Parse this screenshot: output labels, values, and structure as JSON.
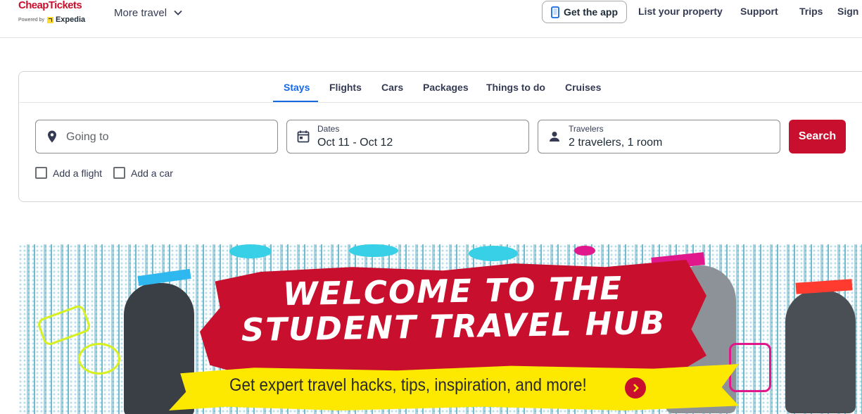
{
  "header": {
    "logo_text": "CheapTickets",
    "logo_powered_by": "Powered by",
    "logo_expedia": "Expedia",
    "more_travel_label": "More travel",
    "get_app_label": "Get the app",
    "list_property_label": "List your property",
    "support_label": "Support",
    "trips_label": "Trips",
    "sign_in_label": "Sign i"
  },
  "search": {
    "tabs": [
      {
        "label": "Stays",
        "active": true
      },
      {
        "label": "Flights"
      },
      {
        "label": "Cars"
      },
      {
        "label": "Packages"
      },
      {
        "label": "Things to do"
      },
      {
        "label": "Cruises"
      }
    ],
    "destination_placeholder": "Going to",
    "dates_label": "Dates",
    "dates_value": "Oct 11 - Oct 12",
    "travelers_label": "Travelers",
    "travelers_value": "2 travelers, 1 room",
    "search_button_label": "Search",
    "add_flight_label": "Add a flight",
    "add_car_label": "Add a car"
  },
  "banner": {
    "headline_line1": "Welcome to the",
    "headline_line2": "Student Travel Hub",
    "subline": "Get expert travel hacks, tips, inspiration, and more!"
  },
  "colors": {
    "brand_red": "#c8102e",
    "accent_blue": "#1668e3",
    "banner_yellow": "#fde800"
  },
  "icons": [
    "chevron-down-icon",
    "phone-icon",
    "location-pin-icon",
    "calendar-icon",
    "person-icon",
    "arrow-right-circle-icon"
  ]
}
